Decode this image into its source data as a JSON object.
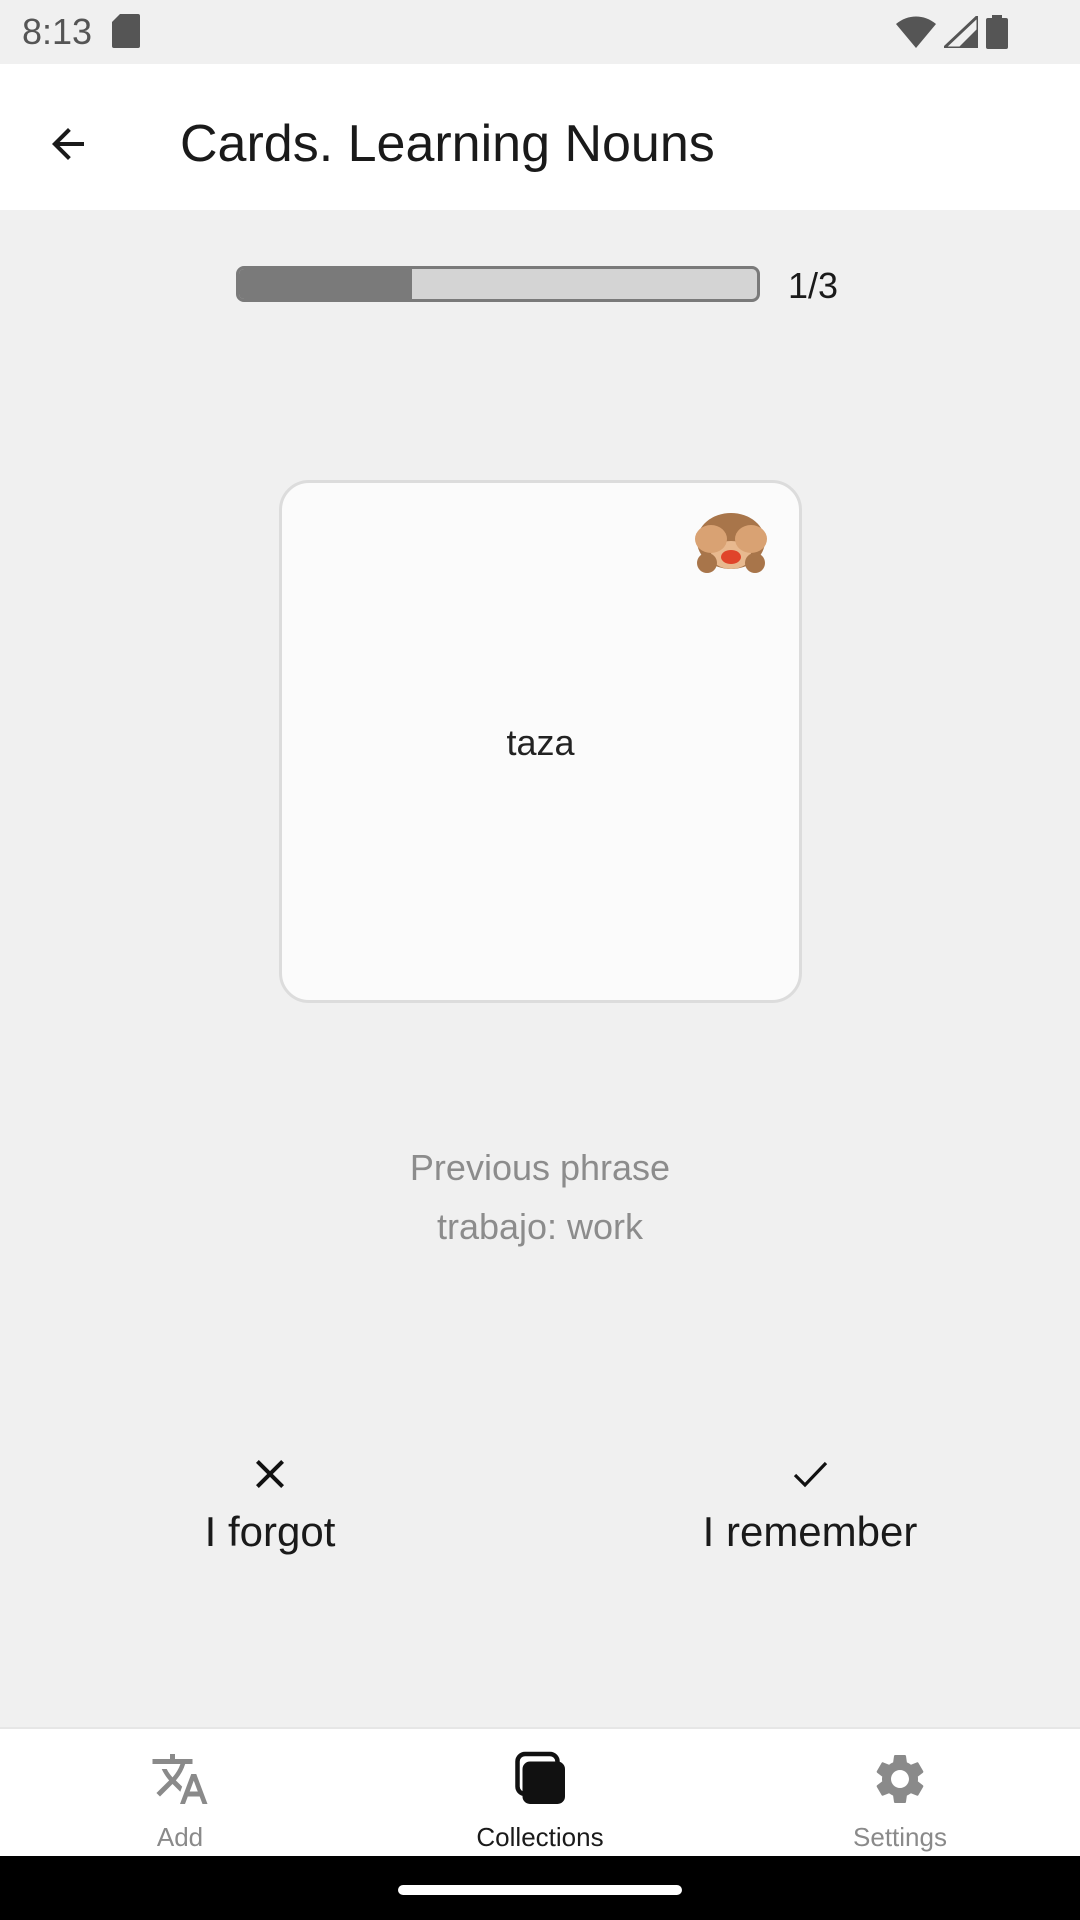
{
  "status_bar": {
    "time": "8:13"
  },
  "app_bar": {
    "title": "Cards. Learning Nouns"
  },
  "progress": {
    "current": 1,
    "total": 3,
    "fraction": 0.3333,
    "label": "1/3"
  },
  "card": {
    "emoji": "see-no-evil-monkey",
    "word": "taza"
  },
  "previous": {
    "label": "Previous phrase",
    "value": "trabajo: work"
  },
  "actions": {
    "forgot_label": "I forgot",
    "remember_label": "I remember"
  },
  "bottom_nav": {
    "items": [
      {
        "label": "Add",
        "icon": "translate-icon",
        "active": false
      },
      {
        "label": "Collections",
        "icon": "collections-icon",
        "active": true
      },
      {
        "label": "Settings",
        "icon": "gear-icon",
        "active": false
      }
    ]
  },
  "colors": {
    "background": "#f0f0f0",
    "surface": "#ffffff",
    "progress_fill": "#7a7a7a",
    "progress_track": "#d4d4d4",
    "muted_text": "#8c8c8c"
  }
}
